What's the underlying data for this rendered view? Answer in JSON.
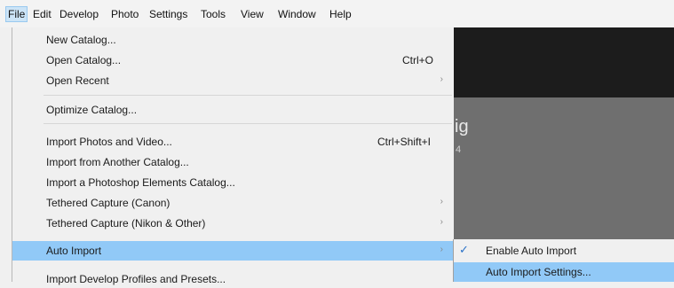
{
  "menubar": {
    "items": [
      "File",
      "Edit",
      "Develop",
      "Photo",
      "Settings",
      "Tools",
      "View",
      "Window",
      "Help"
    ]
  },
  "background": {
    "heading_fragment": "ig",
    "sub_fragment": "4"
  },
  "file_menu": {
    "items": [
      {
        "label": "New Catalog...",
        "shortcut": "",
        "submenu": false
      },
      {
        "label": "Open Catalog...",
        "shortcut": "Ctrl+O",
        "submenu": false
      },
      {
        "label": "Open Recent",
        "shortcut": "",
        "submenu": true
      },
      {
        "label": "Optimize Catalog...",
        "shortcut": "",
        "submenu": false
      },
      {
        "label": "Import Photos and Video...",
        "shortcut": "Ctrl+Shift+I",
        "submenu": false
      },
      {
        "label": "Import from Another Catalog...",
        "shortcut": "",
        "submenu": false
      },
      {
        "label": "Import a Photoshop Elements Catalog...",
        "shortcut": "",
        "submenu": false
      },
      {
        "label": "Tethered Capture (Canon)",
        "shortcut": "",
        "submenu": true
      },
      {
        "label": "Tethered Capture (Nikon & Other)",
        "shortcut": "",
        "submenu": true
      },
      {
        "label": "Auto Import",
        "shortcut": "",
        "submenu": true,
        "highlighted": true
      },
      {
        "label": "Import Develop Profiles and Presets...",
        "shortcut": "",
        "submenu": false
      }
    ]
  },
  "auto_import_submenu": {
    "items": [
      {
        "label": "Enable Auto Import",
        "checked": true
      },
      {
        "label": "Auto Import Settings...",
        "checked": false,
        "highlighted": true
      }
    ]
  },
  "icons": {
    "submenu_arrow": "›",
    "check": "✓"
  },
  "colors": {
    "highlight": "#91c9f7",
    "active_menu": "#cce4f7"
  }
}
